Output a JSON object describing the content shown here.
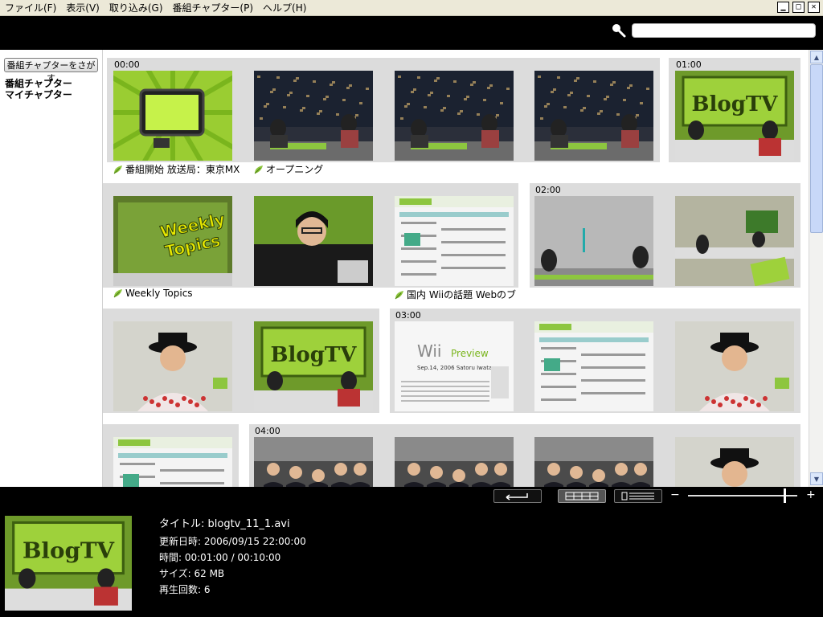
{
  "menu": {
    "items": [
      {
        "label": "ファイル(F)"
      },
      {
        "label": "表示(V)"
      },
      {
        "label": "取り込み(G)"
      },
      {
        "label": "番組チャプター(P)"
      },
      {
        "label": "ヘルプ(H)"
      }
    ],
    "window_controls": [
      "minimize",
      "maximize",
      "close"
    ]
  },
  "search": {
    "value": "",
    "placeholder": ""
  },
  "sidebar": {
    "find_button": "番組チャプターをさがす",
    "links": [
      {
        "label": "番組チャプター"
      },
      {
        "label": "マイチャプター"
      }
    ]
  },
  "grid": {
    "groups": [
      {
        "thumbs": [
          {
            "time": "00:00",
            "chapter": "番組開始  放送局：東京MX",
            "scene": "tv-green"
          },
          {
            "chapter": "オープニング",
            "scene": "studio-night"
          },
          {
            "scene": "studio-night"
          },
          {
            "scene": "studio-night"
          }
        ]
      },
      {
        "thumbs": [
          {
            "time": "01:00",
            "scene": "blogtv"
          },
          {
            "chapter": "Weekly Topics",
            "scene": "weekly"
          },
          {
            "scene": "woman-closeup"
          },
          {
            "chapter": "国内  Wiiの話題  Webのブ",
            "scene": "webpage"
          }
        ]
      },
      {
        "thumbs": [
          {
            "time": "02:00",
            "scene": "studio-gray"
          },
          {
            "scene": "studio-green"
          },
          {
            "scene": "man-hat"
          },
          {
            "scene": "blogtv"
          }
        ]
      },
      {
        "thumbs": [
          {
            "time": "03:00",
            "scene": "wii"
          },
          {
            "scene": "webpage"
          },
          {
            "scene": "man-hat"
          },
          {
            "scene": "webpage"
          }
        ]
      },
      {
        "thumbs": [
          {
            "time": "04:00",
            "scene": "press"
          },
          {
            "scene": "press"
          },
          {
            "scene": "press"
          },
          {
            "scene": "man-hat"
          }
        ]
      }
    ],
    "wii_title": "Wii",
    "wii_subtitle": "Preview",
    "wii_date": "Sep.14, 2006 Satoru Iwata",
    "blogtv_logo": "BlogTV",
    "weekly_logo": "Weekly Topics"
  },
  "controls": {
    "zoom_minus": "−",
    "zoom_plus": "+",
    "zoom_level": 0.88
  },
  "info": {
    "title": "タイトル: blogtv_11_1.avi",
    "updated": "更新日時: 2006/09/15 22:00:00",
    "time": "時間: 00:01:00 / 00:10:00",
    "size": "サイズ: 62 MB",
    "plays": "再生回数: 6"
  },
  "colors": {
    "accent_green": "#8dc63f",
    "menu_bg": "#ece9d8",
    "group_bg": "#dcdcdc"
  }
}
